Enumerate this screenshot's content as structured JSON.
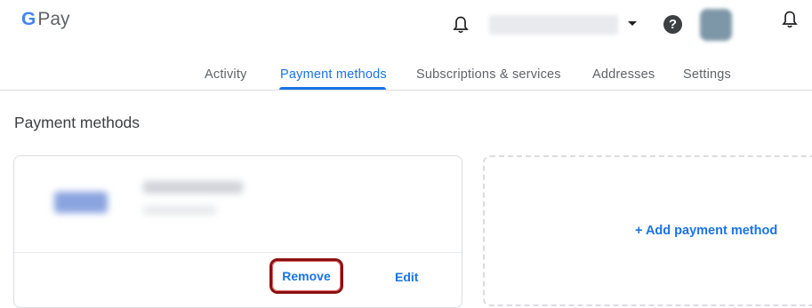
{
  "header": {
    "logo_g": "G",
    "logo_pay": "Pay",
    "help_symbol": "?"
  },
  "nav": {
    "tabs": [
      {
        "label": "Activity",
        "active": false
      },
      {
        "label": "Payment methods",
        "active": true
      },
      {
        "label": "Subscriptions & services",
        "active": false
      },
      {
        "label": "Addresses",
        "active": false
      },
      {
        "label": "Settings",
        "active": false
      }
    ]
  },
  "main": {
    "title": "Payment methods",
    "card": {
      "remove_label": "Remove",
      "edit_label": "Edit"
    },
    "add_label": "+ Add payment method"
  },
  "colors": {
    "accent": "#1a73e8",
    "highlight": "#8b1111"
  },
  "icons": [
    "bell-icon",
    "dropdown-caret-icon",
    "help-icon",
    "avatar",
    "google-g-logo"
  ]
}
